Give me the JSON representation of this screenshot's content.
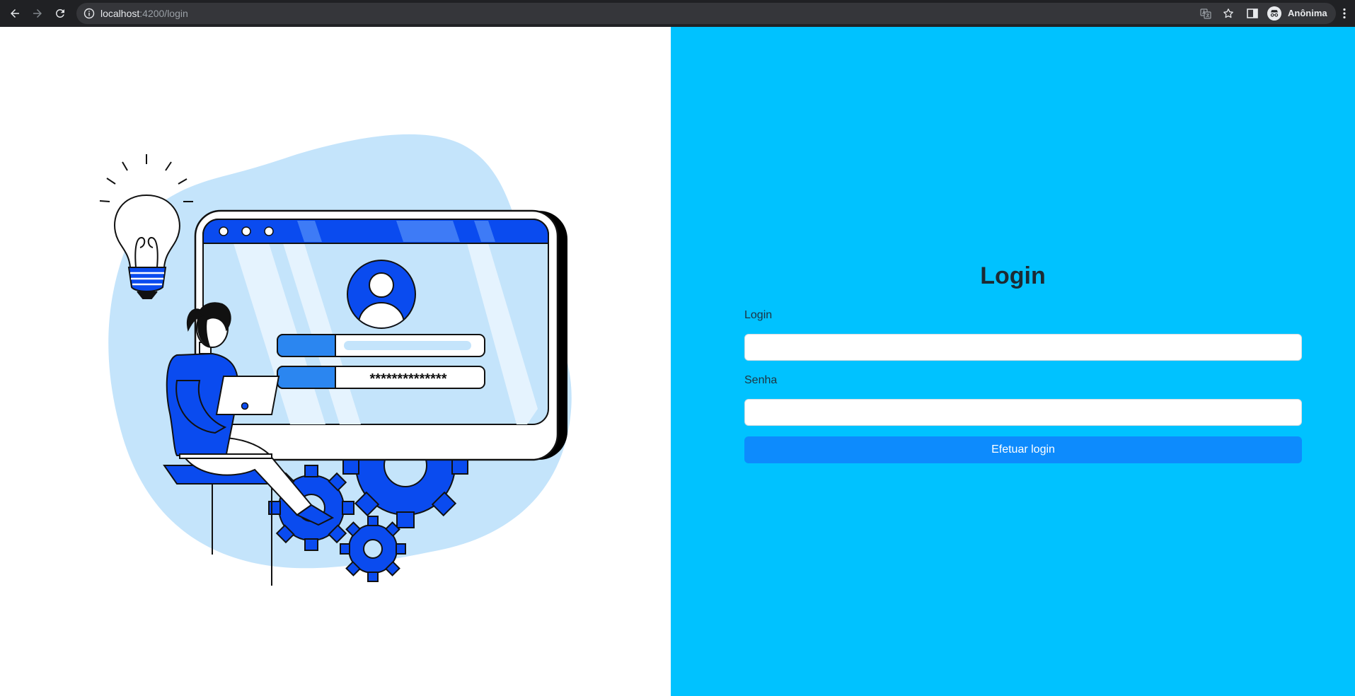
{
  "browser": {
    "url_host": "localhost",
    "url_path": ":4200/login",
    "profile_label": "Anônima",
    "icons": [
      "back-icon",
      "forward-icon",
      "reload-icon",
      "info-icon",
      "translate-icon",
      "star-icon",
      "side-panel-icon",
      "incognito-icon",
      "kebab-menu-icon"
    ]
  },
  "illustration": {
    "password_mask": "**************",
    "colors": {
      "primary": "#0a4bef",
      "light": "#c4e4fb",
      "accent": "#2b86f0"
    }
  },
  "login_form": {
    "title": "Login",
    "login_label": "Login",
    "login_value": "",
    "password_label": "Senha",
    "password_value": "",
    "submit_label": "Efetuar login"
  },
  "colors": {
    "right_background": "#00c2ff",
    "button": "#0d8bfd",
    "chrome": "#202124"
  }
}
